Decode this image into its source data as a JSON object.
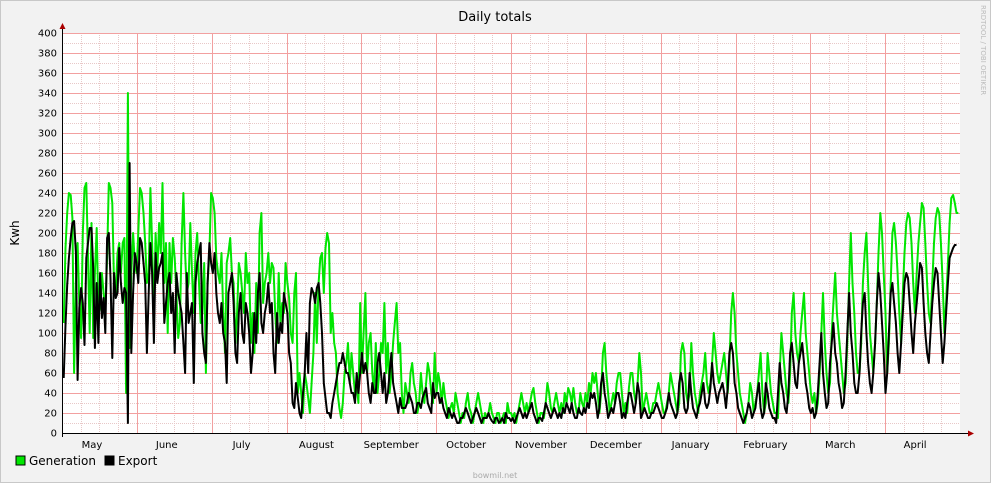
{
  "chart_data": {
    "type": "line",
    "title": "Daily totals",
    "ylabel": "Kwh",
    "xlabel": "",
    "ylim": [
      0,
      400
    ],
    "yticks": [
      0,
      20,
      40,
      60,
      80,
      100,
      120,
      140,
      160,
      180,
      200,
      220,
      240,
      260,
      280,
      300,
      320,
      340,
      360,
      380,
      400
    ],
    "month_labels": [
      "May",
      "June",
      "July",
      "August",
      "September",
      "October",
      "November",
      "December",
      "January",
      "February",
      "March",
      "April"
    ],
    "watermark": "RRDTOOL / TOBI OETIKER",
    "footer": "bowmil.net",
    "grid": true,
    "legend_position": "bottom-left",
    "colors": {
      "generation": "#00e600",
      "export": "#000000",
      "major_grid": "#f2a0a0",
      "minor_grid": "#e8c8c8"
    },
    "series": [
      {
        "name": "Generation",
        "color": "#00e600",
        "values": [
          null,
          110,
          185,
          220,
          240,
          238,
          215,
          60,
          150,
          190,
          130,
          95,
          200,
          245,
          250,
          175,
          100,
          210,
          95,
          160,
          205,
          120,
          125,
          160,
          140,
          120,
          175,
          250,
          245,
          230,
          150,
          140,
          180,
          190,
          160,
          190,
          195,
          40,
          340,
          85,
          160,
          200,
          170,
          160,
          200,
          245,
          240,
          220,
          190,
          150,
          160,
          245,
          190,
          110,
          200,
          160,
          210,
          180,
          250,
          150,
          190,
          100,
          190,
          150,
          195,
          175,
          140,
          95,
          110,
          190,
          240,
          180,
          140,
          150,
          210,
          160,
          120,
          180,
          200,
          150,
          110,
          120,
          170,
          60,
          150,
          180,
          240,
          235,
          220,
          175,
          160,
          150,
          180,
          120,
          80,
          170,
          180,
          195,
          160,
          150,
          90,
          120,
          170,
          160,
          140,
          120,
          180,
          150,
          160,
          90,
          120,
          80,
          150,
          100,
          200,
          220,
          130,
          150,
          160,
          180,
          150,
          170,
          165,
          120,
          90,
          160,
          110,
          130,
          120,
          170,
          150,
          135,
          100,
          90,
          140,
          160,
          40,
          60,
          40,
          20,
          60,
          50,
          35,
          20,
          50,
          80,
          140,
          90,
          150,
          175,
          180,
          140,
          185,
          200,
          190,
          100,
          120,
          90,
          80,
          40,
          25,
          15,
          30,
          60,
          70,
          90,
          50,
          80,
          60,
          40,
          50,
          30,
          130,
          60,
          100,
          140,
          60,
          90,
          100,
          60,
          40,
          90,
          40,
          60,
          90,
          80,
          130,
          60,
          90,
          40,
          60,
          90,
          110,
          130,
          80,
          90,
          40,
          20,
          50,
          40,
          30,
          60,
          70,
          50,
          40,
          20,
          30,
          60,
          40,
          30,
          50,
          70,
          60,
          40,
          30,
          80,
          40,
          60,
          50,
          30,
          50,
          35,
          25,
          15,
          25,
          30,
          20,
          40,
          30,
          20,
          10,
          20,
          15,
          30,
          40,
          25,
          20,
          10,
          20,
          30,
          40,
          30,
          20,
          10,
          20,
          15,
          20,
          30,
          20,
          15,
          10,
          20,
          20,
          10,
          15,
          20,
          10,
          30,
          20,
          20,
          15,
          20,
          10,
          20,
          30,
          40,
          30,
          20,
          30,
          20,
          30,
          40,
          45,
          30,
          20,
          10,
          20,
          20,
          15,
          30,
          50,
          40,
          25,
          20,
          30,
          40,
          30,
          20,
          30,
          20,
          40,
          30,
          45,
          40,
          30,
          45,
          30,
          20,
          20,
          40,
          30,
          25,
          40,
          30,
          50,
          40,
          60,
          50,
          60,
          40,
          20,
          40,
          80,
          90,
          60,
          40,
          20,
          30,
          40,
          30,
          50,
          60,
          60,
          40,
          20,
          30,
          20,
          45,
          60,
          60,
          40,
          30,
          50,
          80,
          60,
          20,
          30,
          40,
          30,
          20,
          20,
          30,
          30,
          40,
          50,
          40,
          30,
          20,
          20,
          30,
          40,
          60,
          50,
          40,
          30,
          20,
          30,
          80,
          90,
          80,
          40,
          30,
          40,
          90,
          60,
          40,
          30,
          20,
          40,
          50,
          60,
          80,
          50,
          40,
          50,
          70,
          100,
          80,
          60,
          50,
          60,
          70,
          80,
          60,
          40,
          70,
          120,
          140,
          120,
          80,
          60,
          40,
          30,
          20,
          10,
          20,
          30,
          50,
          40,
          20,
          30,
          40,
          60,
          80,
          40,
          20,
          30,
          80,
          60,
          40,
          30,
          20,
          20,
          15,
          60,
          100,
          80,
          60,
          40,
          30,
          60,
          120,
          140,
          100,
          80,
          70,
          100,
          120,
          140,
          100,
          80,
          60,
          40,
          30,
          40,
          20,
          30,
          60,
          100,
          140,
          90,
          60,
          40,
          50,
          100,
          130,
          160,
          120,
          100,
          80,
          60,
          40,
          50,
          90,
          150,
          200,
          150,
          120,
          80,
          60,
          60,
          90,
          150,
          180,
          200,
          150,
          100,
          80,
          60,
          90,
          130,
          180,
          220,
          200,
          160,
          120,
          60,
          90,
          150,
          200,
          210,
          190,
          160,
          120,
          90,
          140,
          180,
          210,
          220,
          215,
          190,
          150,
          120,
          160,
          190,
          210,
          230,
          225,
          190,
          150,
          120,
          110,
          150,
          190,
          215,
          225,
          220,
          190,
          150,
          100,
          130,
          170,
          210,
          235,
          238,
          230,
          220,
          220,
          null
        ]
      },
      {
        "name": "Export",
        "color": "#000000",
        "values": [
          null,
          55,
          108,
          148,
          175,
          195,
          210,
          212,
          180,
          53,
          125,
          145,
          130,
          88,
          175,
          190,
          205,
          205,
          165,
          85,
          150,
          90,
          160,
          115,
          135,
          100,
          195,
          200,
          155,
          75,
          160,
          135,
          140,
          185,
          150,
          130,
          145,
          140,
          10,
          270,
          80,
          140,
          180,
          170,
          150,
          195,
          190,
          170,
          150,
          80,
          140,
          190,
          160,
          90,
          180,
          150,
          165,
          170,
          180,
          110,
          130,
          150,
          160,
          120,
          140,
          80,
          160,
          140,
          130,
          120,
          90,
          60,
          160,
          110,
          120,
          130,
          50,
          150,
          170,
          180,
          190,
          100,
          80,
          70,
          150,
          190,
          170,
          160,
          180,
          140,
          120,
          110,
          130,
          100,
          90,
          50,
          140,
          150,
          160,
          130,
          80,
          70,
          120,
          140,
          100,
          90,
          130,
          120,
          100,
          60,
          80,
          120,
          90,
          140,
          160,
          110,
          100,
          120,
          130,
          150,
          120,
          130,
          80,
          60,
          120,
          90,
          110,
          100,
          140,
          130,
          120,
          80,
          70,
          30,
          25,
          50,
          35,
          20,
          15,
          40,
          60,
          100,
          60,
          130,
          145,
          140,
          130,
          145,
          150,
          130,
          100,
          50,
          35,
          20,
          20,
          15,
          30,
          40,
          50,
          60,
          70,
          70,
          80,
          70,
          60,
          60,
          50,
          40,
          40,
          30,
          60,
          40,
          60,
          80,
          60,
          70,
          60,
          40,
          30,
          50,
          40,
          40,
          70,
          80,
          60,
          40,
          60,
          30,
          40,
          60,
          80,
          50,
          40,
          30,
          20,
          35,
          25,
          25,
          25,
          30,
          40,
          35,
          30,
          20,
          20,
          30,
          30,
          25,
          35,
          40,
          45,
          30,
          25,
          20,
          50,
          35,
          40,
          40,
          30,
          35,
          25,
          20,
          15,
          25,
          20,
          15,
          20,
          15,
          10,
          10,
          15,
          15,
          20,
          25,
          20,
          15,
          10,
          15,
          20,
          25,
          20,
          15,
          10,
          15,
          15,
          15,
          20,
          15,
          12,
          10,
          15,
          15,
          10,
          12,
          15,
          10,
          20,
          15,
          15,
          12,
          15,
          10,
          15,
          20,
          25,
          20,
          15,
          20,
          15,
          20,
          25,
          30,
          20,
          15,
          10,
          15,
          15,
          12,
          20,
          30,
          25,
          20,
          15,
          20,
          25,
          20,
          15,
          20,
          15,
          25,
          20,
          30,
          25,
          20,
          30,
          20,
          15,
          15,
          25,
          20,
          18,
          25,
          20,
          30,
          25,
          40,
          35,
          40,
          30,
          15,
          25,
          50,
          60,
          40,
          30,
          15,
          20,
          25,
          20,
          30,
          40,
          40,
          30,
          15,
          20,
          15,
          30,
          40,
          40,
          30,
          20,
          30,
          50,
          40,
          15,
          20,
          25,
          20,
          15,
          15,
          20,
          20,
          25,
          30,
          25,
          20,
          15,
          15,
          20,
          25,
          40,
          30,
          25,
          20,
          15,
          20,
          50,
          60,
          50,
          25,
          20,
          25,
          60,
          40,
          25,
          20,
          15,
          25,
          30,
          40,
          50,
          30,
          25,
          30,
          45,
          70,
          50,
          40,
          30,
          40,
          45,
          50,
          40,
          25,
          45,
          80,
          90,
          80,
          50,
          40,
          25,
          20,
          15,
          10,
          15,
          20,
          30,
          25,
          15,
          20,
          25,
          40,
          50,
          25,
          15,
          20,
          50,
          40,
          25,
          20,
          15,
          15,
          10,
          40,
          70,
          50,
          40,
          25,
          20,
          40,
          80,
          90,
          70,
          50,
          45,
          70,
          80,
          90,
          70,
          50,
          40,
          25,
          20,
          25,
          15,
          20,
          40,
          70,
          100,
          60,
          40,
          25,
          30,
          70,
          90,
          110,
          80,
          70,
          50,
          40,
          25,
          30,
          60,
          100,
          140,
          100,
          80,
          50,
          40,
          40,
          60,
          100,
          130,
          140,
          100,
          70,
          50,
          40,
          60,
          90,
          130,
          160,
          140,
          110,
          80,
          40,
          60,
          100,
          140,
          150,
          130,
          110,
          80,
          60,
          90,
          120,
          150,
          160,
          155,
          130,
          100,
          80,
          110,
          130,
          150,
          170,
          165,
          130,
          100,
          80,
          70,
          100,
          130,
          150,
          165,
          160,
          130,
          100,
          70,
          90,
          120,
          150,
          175,
          180,
          185,
          188,
          188,
          null
        ]
      }
    ]
  },
  "legend": [
    {
      "label": "Generation",
      "color": "#00e600"
    },
    {
      "label": "Export",
      "color": "#000000"
    }
  ]
}
